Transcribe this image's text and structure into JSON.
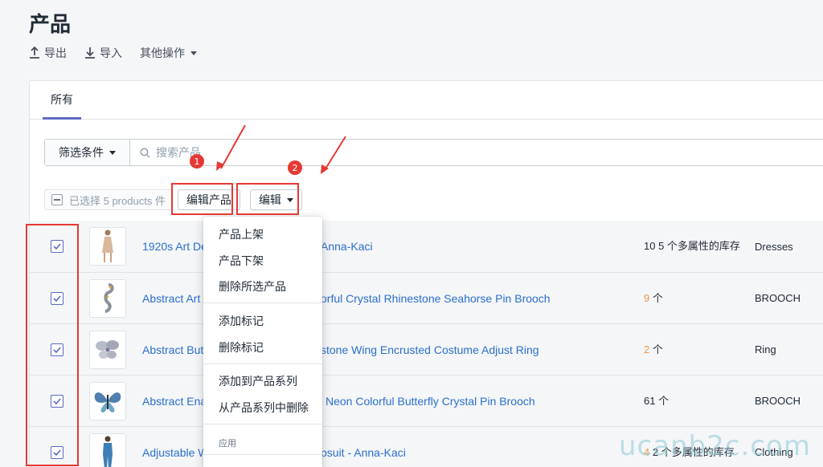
{
  "title": "产品",
  "actions": {
    "export": "导出",
    "import": "导入",
    "more": "其他操作"
  },
  "tabs": [
    {
      "label": "所有"
    }
  ],
  "filter": {
    "label": "筛选条件",
    "search_placeholder": "搜索产品"
  },
  "bulk": {
    "selected": "已选择 5 products 件",
    "edit_products": "编辑产品",
    "edit": "编辑"
  },
  "products": [
    {
      "name_visible": "1920s Art De",
      "name_tail": "Anna-Kaci",
      "inventory_num": "10",
      "inventory_text": "5 个多属性的库存",
      "type": "Dresses",
      "thumb": "dress"
    },
    {
      "name_visible": "Abstract Art",
      "name_tail": "orful Crystal Rhinestone Seahorse Pin Brooch",
      "inventory_num": "9",
      "inventory_text": "个",
      "type": "BROOCH",
      "thumb": "seahorse"
    },
    {
      "name_visible": "Abstract Butt",
      "name_tail": "stone Wing Encrusted Costume Adjust Ring",
      "inventory_num": "2",
      "inventory_text": "个",
      "type": "Ring",
      "thumb": "butterfly-ring"
    },
    {
      "name_visible": "Abstract Ena",
      "name_tail": "Neon Colorful Butterfly Crystal Pin Brooch",
      "inventory_num": "61",
      "inventory_text": "个",
      "type": "BROOCH",
      "thumb": "butterfly"
    },
    {
      "name_visible": "Adjustable W",
      "name_tail": "psuit - Anna-Kaci",
      "inventory_num": "4",
      "inventory_text": "2 个多属性的库存",
      "type": "Clothing",
      "thumb": "jumpsuit"
    }
  ],
  "menu": {
    "items": [
      "产品上架",
      "产品下架",
      "删除所选产品",
      "添加标记",
      "删除标记",
      "添加到产品系列",
      "从产品系列中删除"
    ],
    "section": "应用"
  },
  "annotations": {
    "badge1": "1",
    "badge2": "2"
  },
  "watermark": "ucanb2c.com",
  "colors": {
    "link": "#2c6ecb",
    "accent": "#5c6ac4",
    "highlight": "#e53935",
    "warning": "#f49342"
  }
}
